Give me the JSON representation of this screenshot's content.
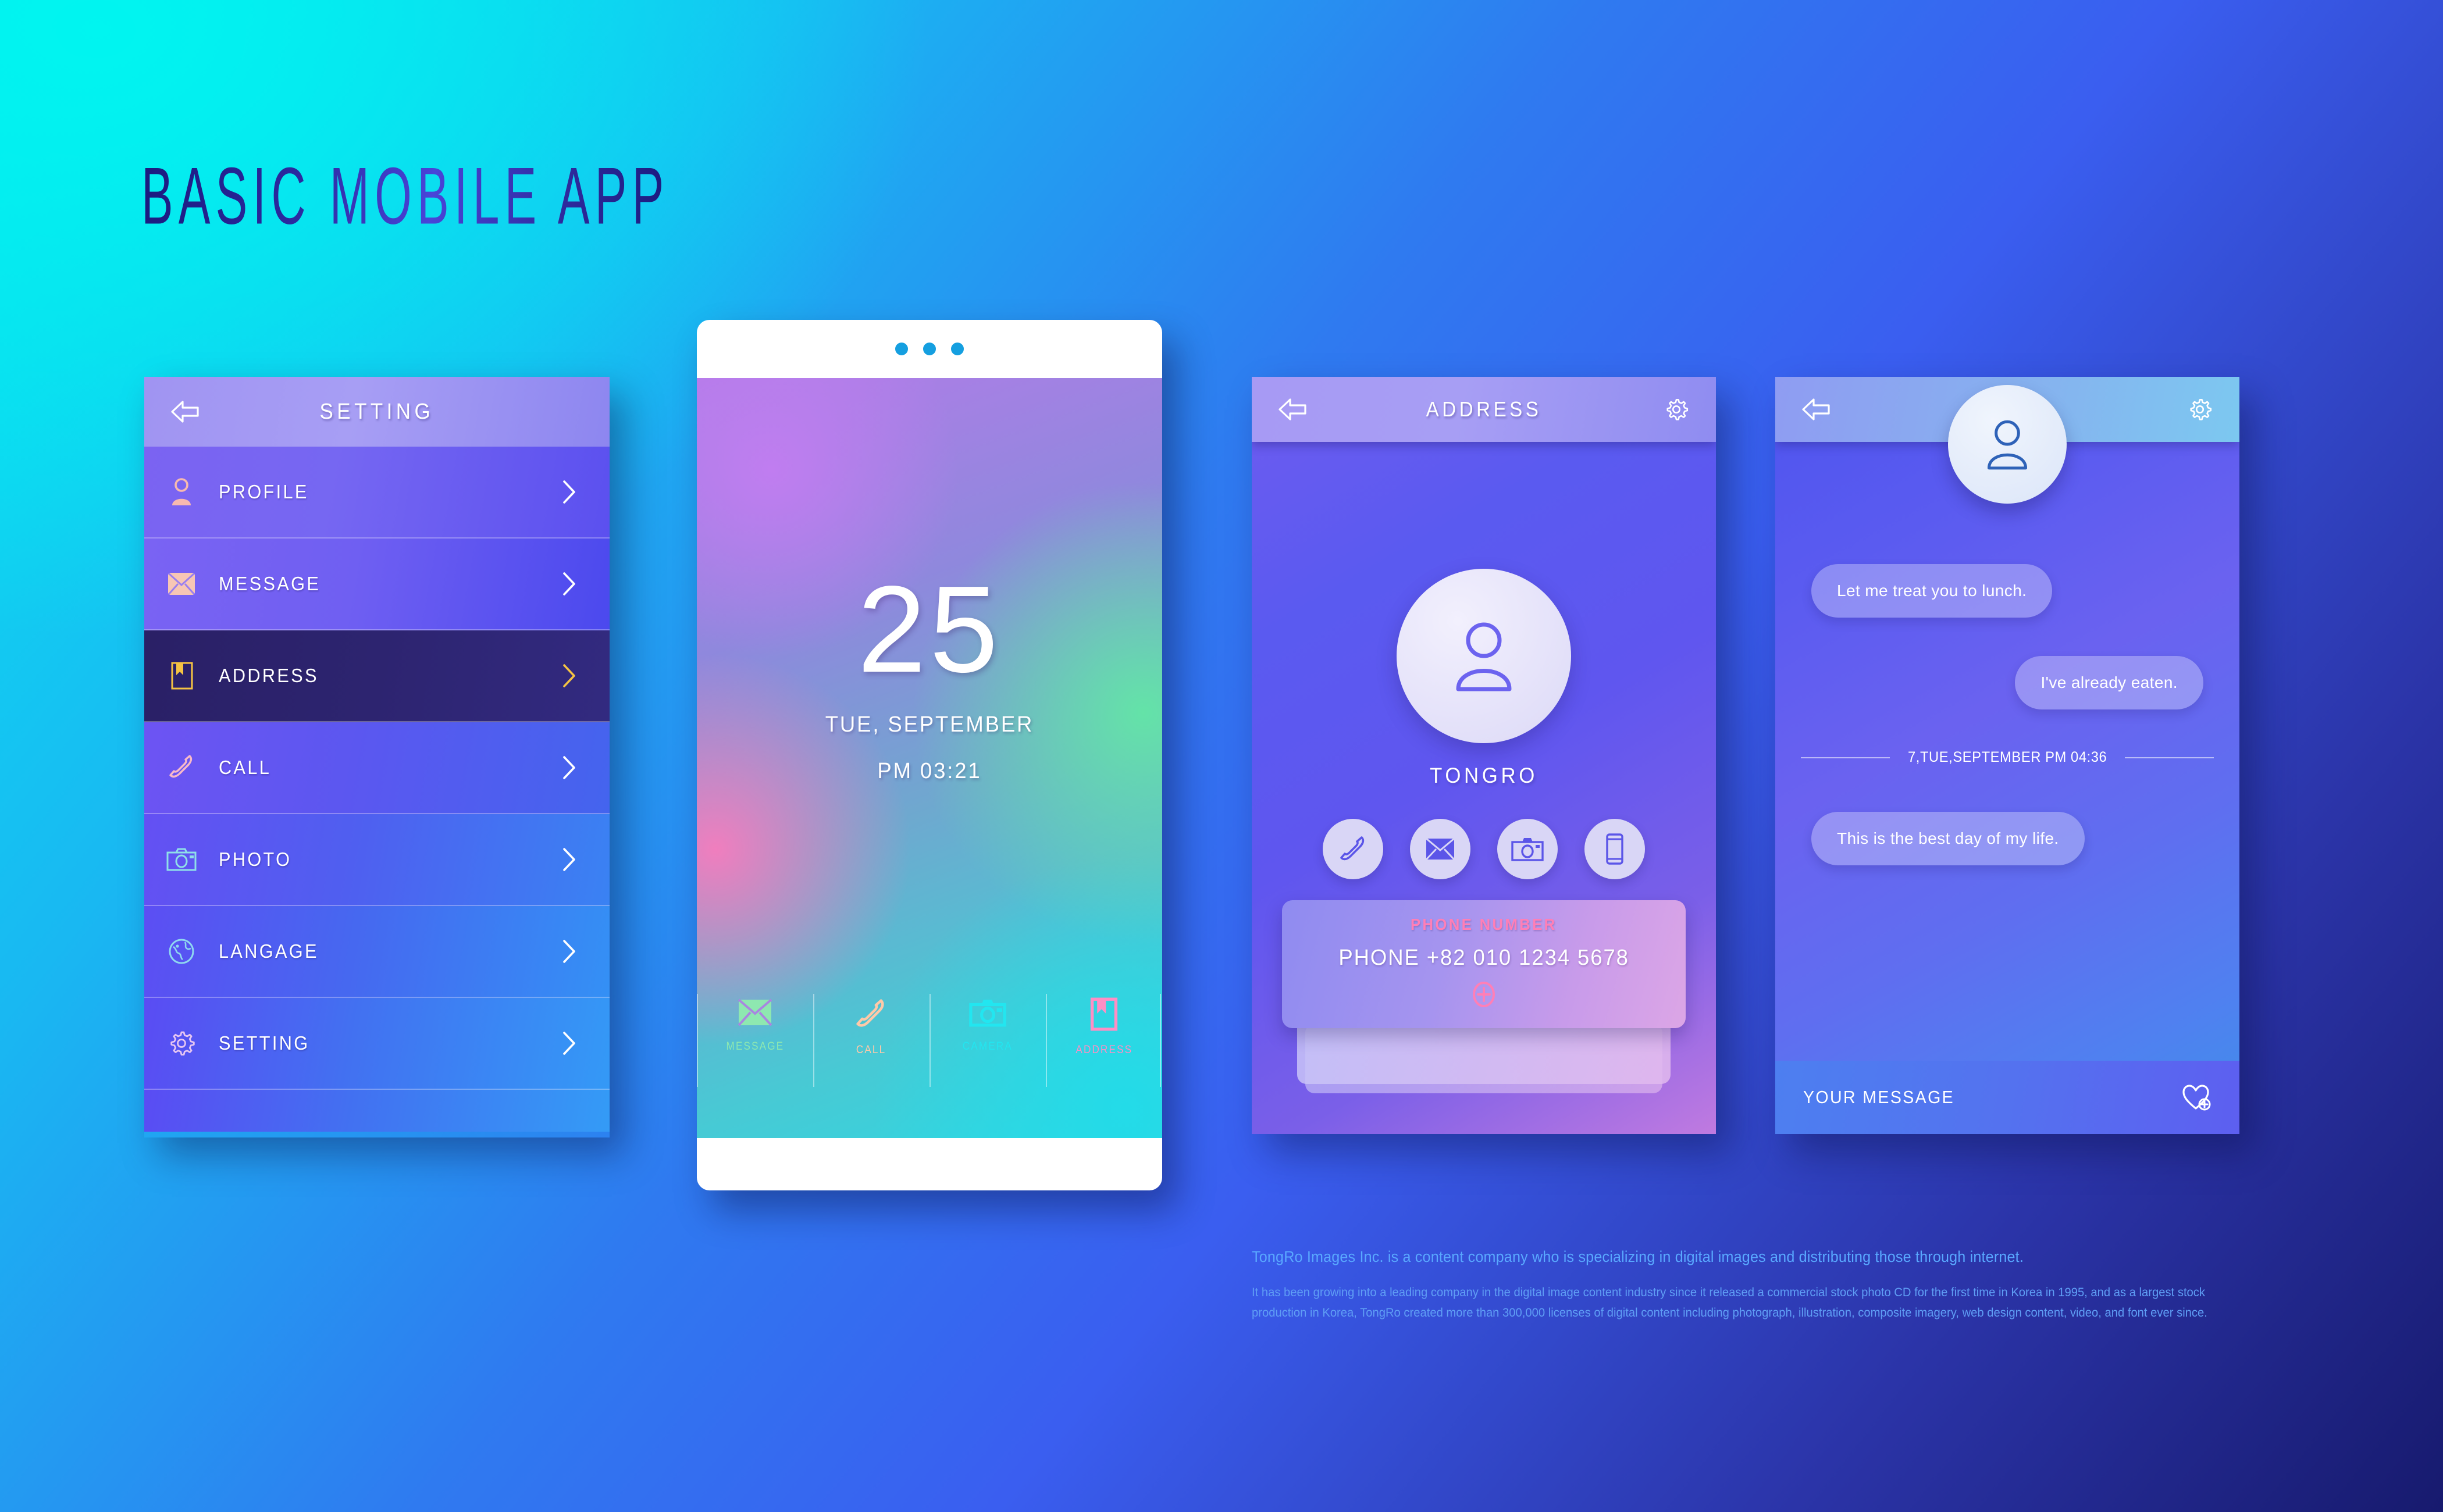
{
  "page": {
    "title": "BASIC MOBILE APP"
  },
  "colors": {
    "bg_cyan": "#08e6f0",
    "bg_blue": "#3a5ef0",
    "bg_navy": "#171a6e",
    "header_lavender": "#a79ef4",
    "accent_yellow": "#f5c343",
    "accent_pink": "#ff7fb6",
    "accent_green": "#8ee8b0",
    "accent_peach": "#ffc9a8",
    "accent_cyan": "#22e6f0",
    "white": "#ffffff"
  },
  "setting_panel": {
    "header": {
      "title": "SETTING",
      "back_icon": "back-arrow-icon"
    },
    "items": [
      {
        "label": "PROFILE",
        "icon": "person-icon",
        "selected": false
      },
      {
        "label": "MESSAGE",
        "icon": "envelope-icon",
        "selected": false
      },
      {
        "label": "ADDRESS",
        "icon": "book-icon",
        "selected": true
      },
      {
        "label": "CALL",
        "icon": "phone-icon",
        "selected": false
      },
      {
        "label": "PHOTO",
        "icon": "camera-icon",
        "selected": false
      },
      {
        "label": "LANGAGE",
        "icon": "globe-icon",
        "selected": false
      },
      {
        "label": "SETTING",
        "icon": "gear-icon",
        "selected": false
      }
    ]
  },
  "phone_panel": {
    "day": "25",
    "date": "TUE, SEPTEMBER",
    "time": "PM 03:21",
    "dock": [
      {
        "label": "MESSAGE",
        "icon": "envelope-icon",
        "color": "#8ee8b0"
      },
      {
        "label": "CALL",
        "icon": "phone-icon",
        "color": "#ffc9a8"
      },
      {
        "label": "CAMERA",
        "icon": "camera-icon",
        "color": "#22e6f0"
      },
      {
        "label": "ADDRESS",
        "icon": "book-icon",
        "color": "#ff8ec4"
      }
    ]
  },
  "address_panel": {
    "header": {
      "title": "ADDRESS",
      "back_icon": "back-arrow-icon",
      "settings_icon": "gear-icon"
    },
    "contact_name": "TONGRO",
    "actions": [
      {
        "icon": "phone-icon",
        "name": "call"
      },
      {
        "icon": "envelope-icon",
        "name": "message"
      },
      {
        "icon": "camera-icon",
        "name": "camera"
      },
      {
        "icon": "mobile-icon",
        "name": "mobile"
      }
    ],
    "card": {
      "heading": "PHONE NUMBER",
      "number": "PHONE   +82 010 1234 5678",
      "add_icon": "plus-circle-icon"
    }
  },
  "chat_panel": {
    "header": {
      "back_icon": "back-arrow-icon",
      "settings_icon": "gear-icon",
      "avatar_icon": "person-icon"
    },
    "messages": [
      {
        "text": "Let me treat you to lunch.",
        "side": "left"
      },
      {
        "text": "I've already eaten.",
        "side": "right"
      },
      {
        "text": "This is the best day of my life.",
        "side": "left"
      }
    ],
    "divider_timestamp": "7,TUE,SEPTEMBER  PM 04:36",
    "input": {
      "placeholder": "YOUR MESSAGE",
      "attach_icon": "heart-plus-icon"
    }
  },
  "footer": {
    "lead": "TongRo Images Inc. is a content company who is specializing in digital images and distributing those through internet.",
    "body": "It has been growing into a leading company in the digital image content industry since it released a commercial stock photo CD for the first time in Korea in 1995, and as a largest stock production in Korea, TongRo created more than 300,000 licenses of digital content including photograph, illustration, composite imagery, web design content, video, and font ever since."
  }
}
